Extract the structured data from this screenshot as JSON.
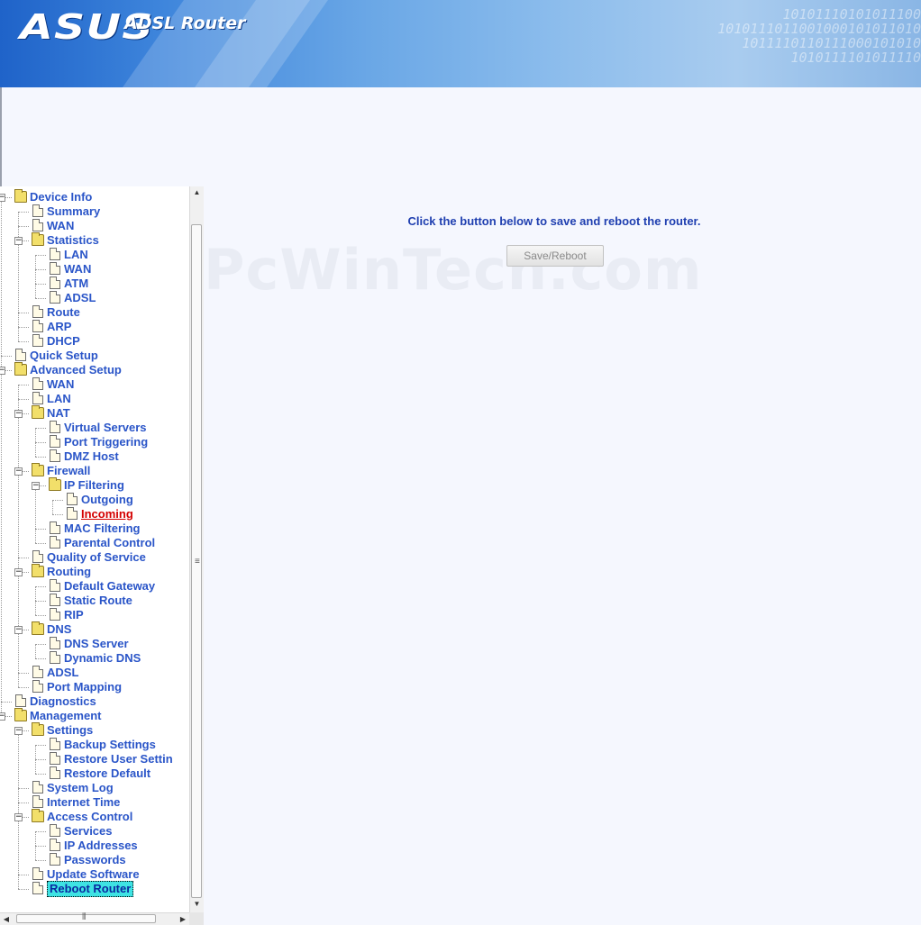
{
  "header": {
    "logo": "ASUS",
    "product": "ADSL Router"
  },
  "main": {
    "message": "Click the button below to save and reboot the router.",
    "button_label": "Save/Reboot",
    "watermark": "PcWinTech.com"
  },
  "tree": [
    {
      "label": "Device Info",
      "level": 0,
      "type": "folder",
      "expanded": true
    },
    {
      "label": "Summary",
      "level": 1,
      "type": "page"
    },
    {
      "label": "WAN",
      "level": 1,
      "type": "page"
    },
    {
      "label": "Statistics",
      "level": 1,
      "type": "folder",
      "expanded": true
    },
    {
      "label": "LAN",
      "level": 2,
      "type": "page"
    },
    {
      "label": "WAN",
      "level": 2,
      "type": "page"
    },
    {
      "label": "ATM",
      "level": 2,
      "type": "page"
    },
    {
      "label": "ADSL",
      "level": 2,
      "type": "page"
    },
    {
      "label": "Route",
      "level": 1,
      "type": "page"
    },
    {
      "label": "ARP",
      "level": 1,
      "type": "page"
    },
    {
      "label": "DHCP",
      "level": 1,
      "type": "page"
    },
    {
      "label": "Quick Setup",
      "level": 0,
      "type": "page"
    },
    {
      "label": "Advanced Setup",
      "level": 0,
      "type": "folder",
      "expanded": true
    },
    {
      "label": "WAN",
      "level": 1,
      "type": "page"
    },
    {
      "label": "LAN",
      "level": 1,
      "type": "page"
    },
    {
      "label": "NAT",
      "level": 1,
      "type": "folder",
      "expanded": true
    },
    {
      "label": "Virtual Servers",
      "level": 2,
      "type": "page"
    },
    {
      "label": "Port Triggering",
      "level": 2,
      "type": "page"
    },
    {
      "label": "DMZ Host",
      "level": 2,
      "type": "page"
    },
    {
      "label": "Firewall",
      "level": 1,
      "type": "folder",
      "expanded": true
    },
    {
      "label": "IP Filtering",
      "level": 2,
      "type": "folder",
      "expanded": true
    },
    {
      "label": "Outgoing",
      "level": 3,
      "type": "page"
    },
    {
      "label": "Incoming",
      "level": 3,
      "type": "page",
      "state": "active"
    },
    {
      "label": "MAC Filtering",
      "level": 2,
      "type": "page"
    },
    {
      "label": "Parental Control",
      "level": 2,
      "type": "page"
    },
    {
      "label": "Quality of Service",
      "level": 1,
      "type": "page"
    },
    {
      "label": "Routing",
      "level": 1,
      "type": "folder",
      "expanded": true
    },
    {
      "label": "Default Gateway",
      "level": 2,
      "type": "page"
    },
    {
      "label": "Static Route",
      "level": 2,
      "type": "page"
    },
    {
      "label": "RIP",
      "level": 2,
      "type": "page"
    },
    {
      "label": "DNS",
      "level": 1,
      "type": "folder",
      "expanded": true
    },
    {
      "label": "DNS Server",
      "level": 2,
      "type": "page"
    },
    {
      "label": "Dynamic DNS",
      "level": 2,
      "type": "page"
    },
    {
      "label": "ADSL",
      "level": 1,
      "type": "page"
    },
    {
      "label": "Port Mapping",
      "level": 1,
      "type": "page"
    },
    {
      "label": "Diagnostics",
      "level": 0,
      "type": "page"
    },
    {
      "label": "Management",
      "level": 0,
      "type": "folder",
      "expanded": true
    },
    {
      "label": "Settings",
      "level": 1,
      "type": "folder",
      "expanded": true
    },
    {
      "label": "Backup Settings",
      "level": 2,
      "type": "page"
    },
    {
      "label": "Restore User Settin",
      "level": 2,
      "type": "page"
    },
    {
      "label": "Restore Default",
      "level": 2,
      "type": "page"
    },
    {
      "label": "System Log",
      "level": 1,
      "type": "page"
    },
    {
      "label": "Internet Time",
      "level": 1,
      "type": "page"
    },
    {
      "label": "Access Control",
      "level": 1,
      "type": "folder",
      "expanded": true
    },
    {
      "label": "Services",
      "level": 2,
      "type": "page"
    },
    {
      "label": "IP Addresses",
      "level": 2,
      "type": "page"
    },
    {
      "label": "Passwords",
      "level": 2,
      "type": "page"
    },
    {
      "label": "Update Software",
      "level": 1,
      "type": "page"
    },
    {
      "label": "Reboot Router",
      "level": 1,
      "type": "page",
      "state": "selected"
    }
  ],
  "icons": {
    "folder": "folder-icon",
    "page": "page-icon",
    "collapse": "collapse-toggle-icon"
  },
  "colors": {
    "link": "#2a55c8",
    "active": "#d40000",
    "selected_bg": "#3ee3e3",
    "message": "#1f3fb0"
  }
}
